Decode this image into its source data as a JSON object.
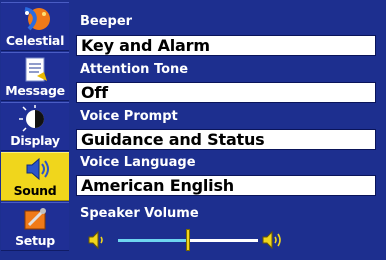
{
  "tabs": [
    {
      "label": "Celestial",
      "icon": "celestial-icon",
      "selected": false
    },
    {
      "label": "Message",
      "icon": "message-icon",
      "selected": false
    },
    {
      "label": "Display",
      "icon": "display-icon",
      "selected": false
    },
    {
      "label": "Sound",
      "icon": "sound-icon",
      "selected": true
    },
    {
      "label": "Setup",
      "icon": "setup-icon",
      "selected": false
    }
  ],
  "fields": {
    "beeper": {
      "label": "Beeper",
      "value": "Key and Alarm"
    },
    "attention_tone": {
      "label": "Attention Tone",
      "value": "Off"
    },
    "voice_prompt": {
      "label": "Voice Prompt",
      "value": "Guidance and Status"
    },
    "voice_language": {
      "label": "Voice Language",
      "value": "American English"
    }
  },
  "speaker_volume": {
    "label": "Speaker Volume",
    "level": 0.5
  },
  "colors": {
    "background": "#1d2f8f",
    "selected_tab": "#f0d61c",
    "slider_fill": "#6fd6f0",
    "slider_thumb": "#f3d520"
  }
}
